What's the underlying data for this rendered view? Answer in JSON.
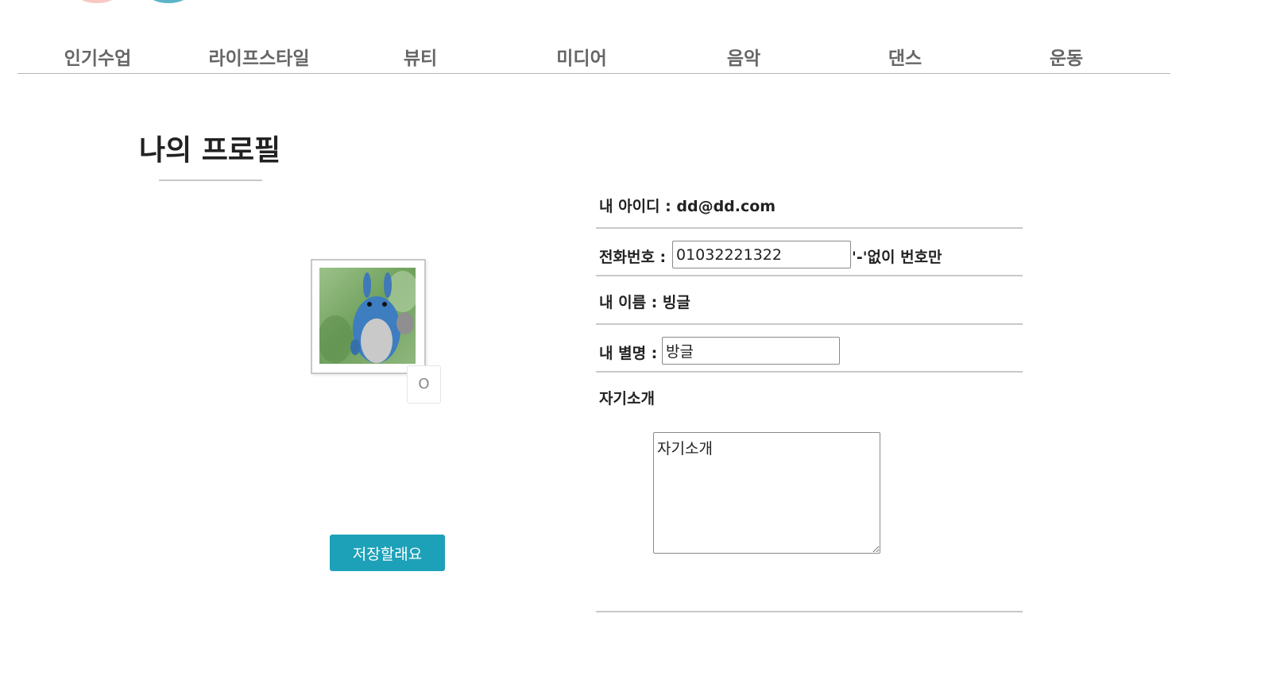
{
  "nav": {
    "items": [
      {
        "label": "인기수업"
      },
      {
        "label": "라이프스타일"
      },
      {
        "label": "뷰티"
      },
      {
        "label": "미디어"
      },
      {
        "label": "음악"
      },
      {
        "label": "댄스"
      },
      {
        "label": "운동"
      }
    ]
  },
  "page": {
    "title": "나의 프로필"
  },
  "avatar": {
    "change_button_label": "O"
  },
  "profile": {
    "id_label": "내 아이디 :",
    "id_value": "dd@dd.com",
    "phone_label": "전화번호 :",
    "phone_value": "01032221322",
    "phone_hint": "'-'없이 번호만",
    "name_label": "내 이름 :",
    "name_value": "빙글",
    "nickname_label": "내 별명 :",
    "nickname_value": "방글",
    "intro_label": "자기소개",
    "intro_value": "자기소개"
  },
  "actions": {
    "save_label": "저장할래요"
  },
  "colors": {
    "accent": "#1da1b8",
    "logo_pink": "#f7c9c2",
    "logo_teal": "#5db4c7"
  }
}
